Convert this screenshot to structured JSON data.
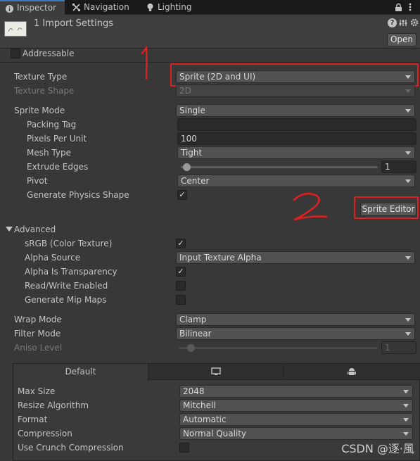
{
  "tabs": [
    {
      "label": "Inspector",
      "icon": "info-icon"
    },
    {
      "label": "Navigation",
      "icon": "navigation-icon"
    },
    {
      "label": "Lighting",
      "icon": "lightbulb-icon"
    }
  ],
  "header": {
    "title": "1 Import Settings",
    "open_label": "Open",
    "help_icon": "?"
  },
  "addressable": {
    "label": "Addressable",
    "checked": false
  },
  "texture_type": {
    "label": "Texture Type",
    "value": "Sprite (2D and UI)"
  },
  "texture_shape": {
    "label": "Texture Shape",
    "value": "2D"
  },
  "sprite_mode": {
    "label": "Sprite Mode",
    "value": "Single"
  },
  "packing_tag": {
    "label": "Packing Tag",
    "value": ""
  },
  "pixels_per_unit": {
    "label": "Pixels Per Unit",
    "value": "100"
  },
  "mesh_type": {
    "label": "Mesh Type",
    "value": "Tight"
  },
  "extrude_edges": {
    "label": "Extrude Edges",
    "value": "1"
  },
  "pivot": {
    "label": "Pivot",
    "value": "Center"
  },
  "generate_physics_shape": {
    "label": "Generate Physics Shape",
    "checked": true
  },
  "sprite_editor_label": "Sprite Editor",
  "advanced": {
    "label": "Advanced",
    "srgb": {
      "label": "sRGB (Color Texture)",
      "checked": true
    },
    "alpha_source": {
      "label": "Alpha Source",
      "value": "Input Texture Alpha"
    },
    "alpha_is_transparency": {
      "label": "Alpha Is Transparency",
      "checked": true
    },
    "read_write": {
      "label": "Read/Write Enabled",
      "checked": false
    },
    "mip_maps": {
      "label": "Generate Mip Maps",
      "checked": false
    }
  },
  "wrap_mode": {
    "label": "Wrap Mode",
    "value": "Clamp"
  },
  "filter_mode": {
    "label": "Filter Mode",
    "value": "Bilinear"
  },
  "aniso_level": {
    "label": "Aniso Level",
    "value": "1"
  },
  "platform": {
    "tabs": [
      {
        "label": "Default",
        "icon": ""
      },
      {
        "label": "",
        "icon": "monitor-icon"
      },
      {
        "label": "",
        "icon": "android-icon"
      }
    ],
    "max_size": {
      "label": "Max Size",
      "value": "2048"
    },
    "resize_algorithm": {
      "label": "Resize Algorithm",
      "value": "Mitchell"
    },
    "format": {
      "label": "Format",
      "value": "Automatic"
    },
    "compression": {
      "label": "Compression",
      "value": "Normal Quality"
    },
    "crunch": {
      "label": "Use Crunch Compression",
      "checked": false
    }
  },
  "annotations": {
    "one": "1",
    "two": "2"
  },
  "watermark": "CSDN @逐·風",
  "colors": {
    "accent": "#3a79bb",
    "highlight_box": "#e02020",
    "background": "#383838"
  }
}
